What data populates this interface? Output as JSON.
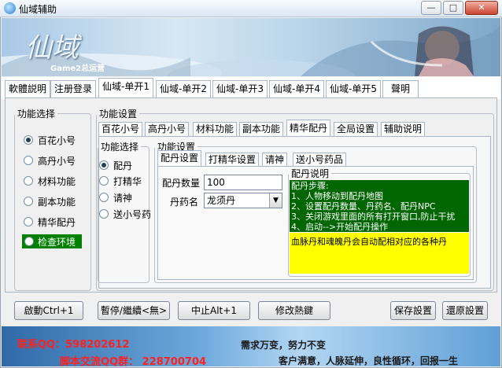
{
  "window": {
    "title": "仙域辅助",
    "buttons": {
      "minimize": "—",
      "maximize": "□",
      "close": "✕"
    }
  },
  "banner": {
    "logo_text": "仙域",
    "logo_sub": "Game2总运营"
  },
  "main_tabs": [
    {
      "label": "軟體説明"
    },
    {
      "label": "注册登录"
    },
    {
      "label": "仙域-单开1"
    },
    {
      "label": "仙域-单开2"
    },
    {
      "label": "仙域-单开3"
    },
    {
      "label": "仙域-单开4"
    },
    {
      "label": "仙域-单开5"
    },
    {
      "label": "聲明"
    }
  ],
  "left_group": {
    "legend": "功能选择",
    "options": [
      "百花小号",
      "高丹小号",
      "材料功能",
      "副本功能",
      "精华配丹"
    ],
    "selected": "百花小号",
    "check_env_label": "检查环境"
  },
  "settings_group": {
    "legend": "功能设置",
    "tabs": [
      "百花小号",
      "高丹小号",
      "材料功能",
      "副本功能",
      "精华配丹",
      "全局设置",
      "辅助说明"
    ],
    "selected_tab": "精华配丹"
  },
  "inner_select": {
    "legend": "功能选择",
    "options": [
      "配丹",
      "打精华",
      "请神",
      "送小号药"
    ],
    "selected": "配丹"
  },
  "inner_settings": {
    "legend": "功能设置",
    "tabs": [
      "配丹设置",
      "打精华设置",
      "请神",
      "送小号药品"
    ],
    "selected_tab": "配丹设置",
    "quantity_label": "配丹数量",
    "quantity_value": "100",
    "pill_label": "丹药名",
    "pill_value": "龙须丹"
  },
  "info": {
    "legend": "配丹说明",
    "steps_title": "配丹步骤:",
    "steps": [
      "1、人物移动到配丹地图",
      "2、设置配丹数量、丹药名、配丹NPC",
      "3、关闭游戏里面的所有打开窗口,防止干扰",
      "4、启动-->开始配丹操作"
    ],
    "note": "血脉丹和魂魄丹会自动配相对应的各种丹"
  },
  "bottom_buttons": {
    "start": "啟動Ctrl+1",
    "pause": "暫停/繼續<無>",
    "stop": "中止Alt+1",
    "hotkey": "修改熱鍵",
    "save": "保存設置",
    "restore": "還原設置"
  },
  "footer": {
    "qq": "联系QQ：598202612",
    "group": "脚本交流QQ群： 228700704",
    "slogan1": "需求万变，努力不变",
    "slogan2": "客户满意，人脉延伸，良性循环，回报一生"
  },
  "colors": {
    "steps_bg": "#006600",
    "note_bg": "#ffff00",
    "check_env_bg": "#008000",
    "footer_red": "#ff2020"
  }
}
